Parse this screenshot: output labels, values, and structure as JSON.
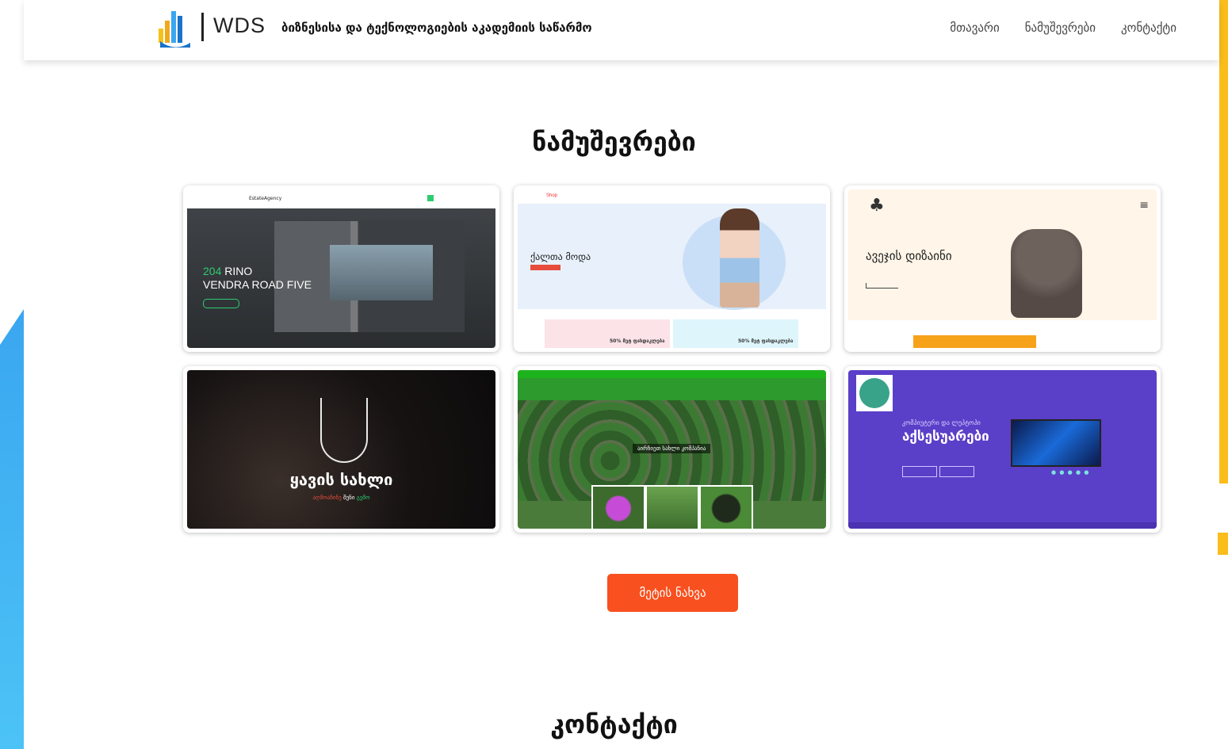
{
  "header": {
    "logo_text": "WDS",
    "site_title": "ბიზნესისა და ტექნოლოგიების აკადემიის საწარმო",
    "nav": [
      "მთავარი",
      "ნამუშევრები",
      "კონტაქტი"
    ]
  },
  "works": {
    "title": "ნამუშევრები",
    "cards": [
      {
        "brand": "EstateAgency",
        "price_num": "204",
        "price_rest": " RINO",
        "address": "VENDRA ROAD FIVE"
      },
      {
        "logo": "Shop",
        "hero_text": "ქალთა მოდა",
        "promo1": "50% მეტ ფასდაკლება",
        "promo2": "50% მეტ ფასდაკლება"
      },
      {
        "hero_text": "ავეჯის დიზაინი"
      },
      {
        "title": "ყავის სახლი",
        "sub_red": "აღმოაჩინე",
        "sub_white": " შენი ",
        "sub_green": "გემო"
      },
      {
        "caption": "აირჩიეთ სახლი კომპანია"
      },
      {
        "sub": "კომპიუტერი და ლეპტოპი",
        "title": "აქსესუარები",
        "dots": "● ● ● ● ●"
      }
    ],
    "more_button": "მეტის ნახვა"
  },
  "contact": {
    "title": "კონტაქტი"
  },
  "colors": {
    "accent_orange": "#f8501f",
    "yellow_deco": "#fbbd1b",
    "blue_deco": "#3aa6f0"
  }
}
